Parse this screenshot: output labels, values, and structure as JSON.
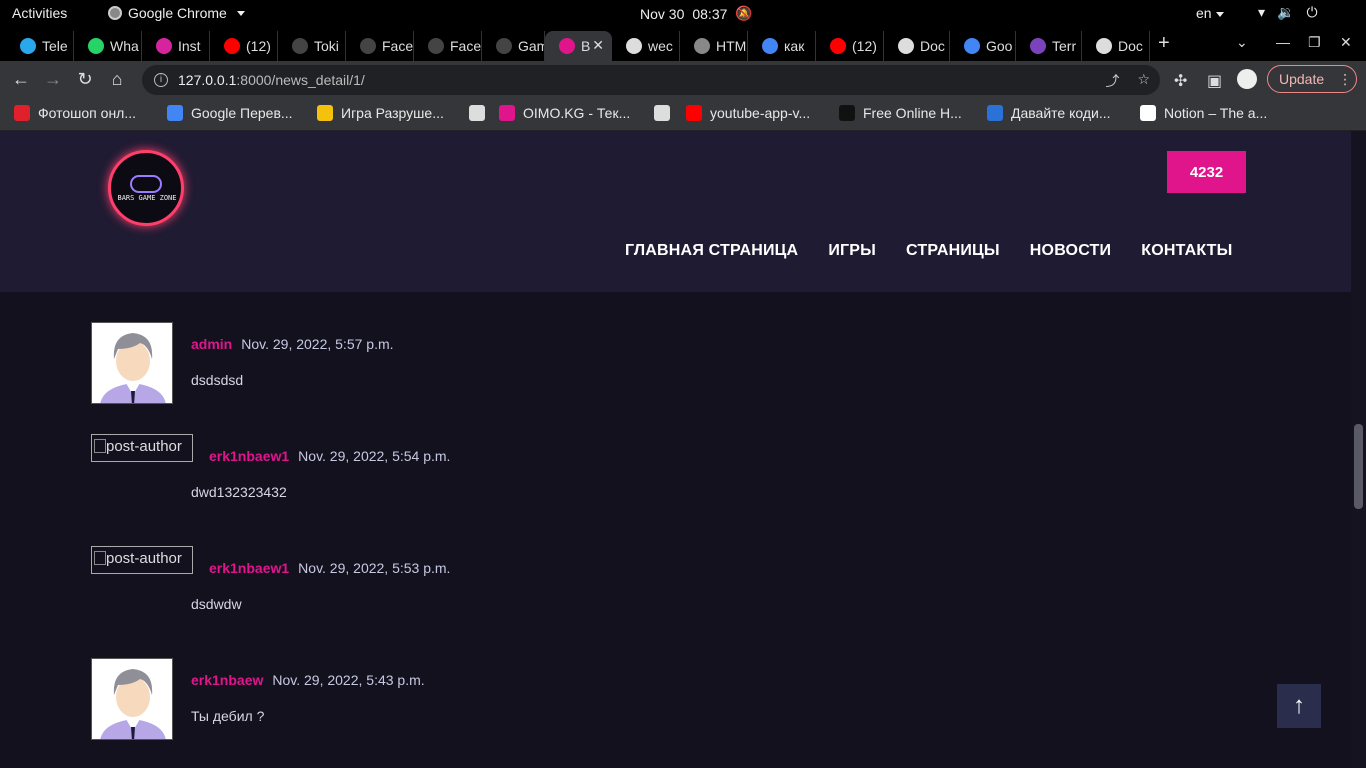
{
  "os": {
    "activities": "Activities",
    "app_name": "Google Chrome",
    "date": "Nov 30",
    "time": "08:37",
    "lang": "en"
  },
  "tabs": [
    {
      "title": "Tele",
      "color": "#29a9eb"
    },
    {
      "title": "Wha",
      "color": "#25d366"
    },
    {
      "title": "Inst",
      "color": "#d6249f"
    },
    {
      "title": "(12)",
      "color": "#ff0000"
    },
    {
      "title": "Toki",
      "color": "#444444"
    },
    {
      "title": "Face",
      "color": "#444444"
    },
    {
      "title": "Face",
      "color": "#444444"
    },
    {
      "title": "Gam",
      "color": "#444444"
    },
    {
      "title": "B",
      "color": "#e0158c",
      "active": true
    },
    {
      "title": "wec",
      "color": "#dddddd"
    },
    {
      "title": "HTM",
      "color": "#888888"
    },
    {
      "title": "как",
      "color": "#4285f4"
    },
    {
      "title": "(12)",
      "color": "#ff0000"
    },
    {
      "title": "Doc",
      "color": "#dddddd"
    },
    {
      "title": "Goo",
      "color": "#4285f4"
    },
    {
      "title": "Terr",
      "color": "#7b42bc"
    },
    {
      "title": "Doc",
      "color": "#dddddd"
    }
  ],
  "browser": {
    "url_host": "127.0.0.1",
    "url_path": ":8000/news_detail/1/",
    "update_label": "Update"
  },
  "bookmarks": [
    {
      "label": "Фотошоп онл...",
      "color": "#e0202a"
    },
    {
      "label": "Google Перев...",
      "color": "#4285f4"
    },
    {
      "label": "Игра Разруше...",
      "color": "#f4c20d"
    },
    {
      "label": "",
      "color": "#dddddd"
    },
    {
      "label": "OIMO.KG - Тек...",
      "color": "#e0158c"
    },
    {
      "label": "",
      "color": "#dddddd"
    },
    {
      "label": "youtube-app-v...",
      "color": "#ff0000"
    },
    {
      "label": "Free Online H...",
      "color": "#111111"
    },
    {
      "label": "Давайте коди...",
      "color": "#2a72d8"
    },
    {
      "label": "Notion – The a...",
      "color": "#ffffff"
    }
  ],
  "site": {
    "logo_text": "BARS GAME ZONE",
    "cta_label": "4232",
    "nav": [
      "ГЛАВНАЯ СТРАНИЦА",
      "ИГРЫ",
      "СТРАНИЦЫ",
      "НОВОСТИ",
      "КОНТАКТЫ"
    ]
  },
  "comments": [
    {
      "author": "admin",
      "date": "Nov. 29, 2022, 5:57 p.m.",
      "text": "dsdsdsd",
      "avatar": "image"
    },
    {
      "author": "erk1nbaew1",
      "date": "Nov. 29, 2022, 5:54 p.m.",
      "text": "dwd132323432",
      "avatar": "broken",
      "alt": "post-author"
    },
    {
      "author": "erk1nbaew1",
      "date": "Nov. 29, 2022, 5:53 p.m.",
      "text": "dsdwdw",
      "avatar": "broken",
      "alt": "post-author"
    },
    {
      "author": "erk1nbaew",
      "date": "Nov. 29, 2022, 5:43 p.m.",
      "text": "Ты дебил ?",
      "avatar": "image"
    }
  ],
  "colors": {
    "accent": "#e0158c",
    "header_bg": "#1f1b33",
    "page_bg": "#14111f"
  }
}
